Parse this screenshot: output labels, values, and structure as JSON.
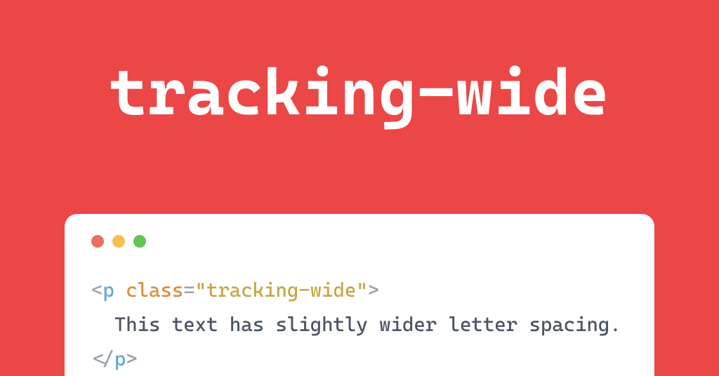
{
  "hero": {
    "title": "tracking-wide"
  },
  "code": {
    "line1": {
      "open_bracket": "<",
      "tag": "p",
      "space": " ",
      "attr": "class",
      "eq": "=",
      "string": "\"tracking-wide\"",
      "close_bracket": ">"
    },
    "line2": {
      "text": "This text has slightly wider letter spacing."
    },
    "line3": {
      "open_bracket": "</",
      "tag": "p",
      "close_bracket": ">"
    }
  }
}
